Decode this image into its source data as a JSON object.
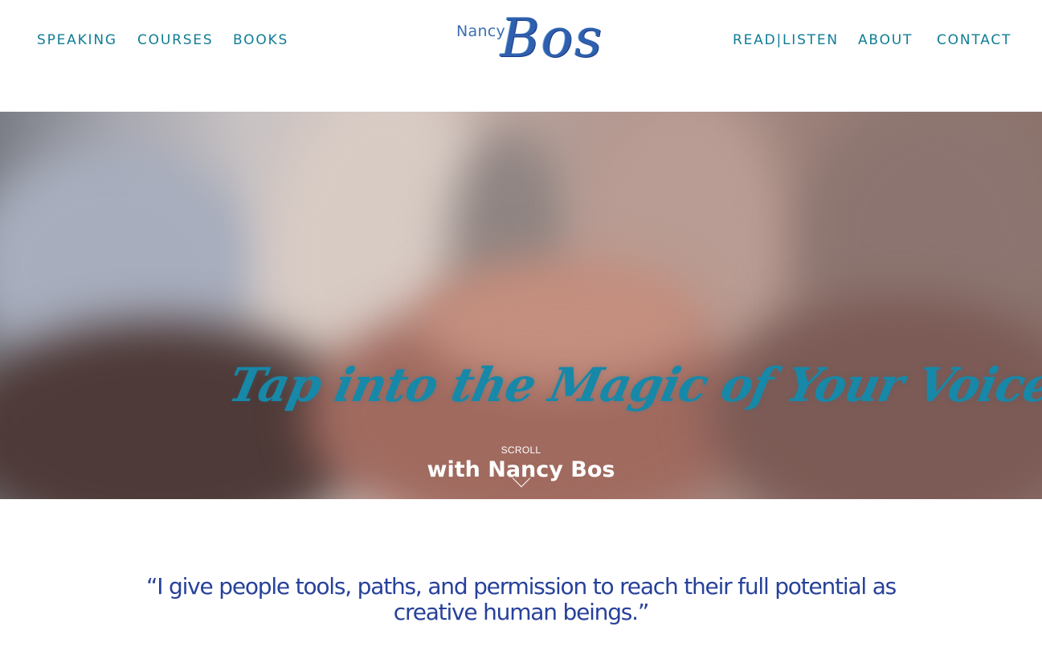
{
  "nav": {
    "left": [
      {
        "label": "SPEAKING"
      },
      {
        "label": "COURSES"
      },
      {
        "label": "BOOKS"
      }
    ],
    "right": [
      {
        "label": "READ|LISTEN"
      },
      {
        "label": "ABOUT"
      },
      {
        "label": "CONTACT"
      }
    ]
  },
  "logo": {
    "first": "Nancy",
    "last": "Bos"
  },
  "hero": {
    "title": "Tap into the Magic of Your Voice",
    "scroll_label": "SCROLL",
    "subtitle": "with Nancy Bos",
    "scroll_icon": "chevron-down-icon"
  },
  "quote": {
    "text": "“I give people tools, paths, and permission to reach their full potential as creative human beings.”"
  },
  "colors": {
    "nav": "#0f7d95",
    "hero_title": "#1788a8",
    "quote": "#27419a",
    "logo": "#2f5fae"
  }
}
